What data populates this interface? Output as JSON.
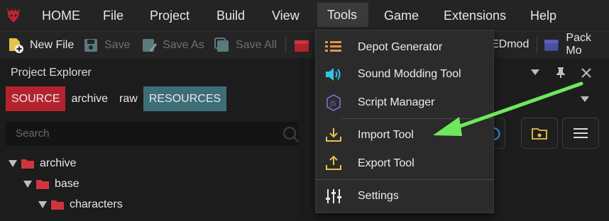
{
  "menubar": {
    "items": [
      "HOME",
      "File",
      "Project",
      "Build",
      "View",
      "Tools",
      "Game",
      "Extensions",
      "Help"
    ]
  },
  "toolbar": {
    "new_file": "New File",
    "save": "Save",
    "save_as": "Save As",
    "save_all": "Save All",
    "redmod": "EDmod",
    "pack_mod": "Pack Mo"
  },
  "explorer": {
    "title": "Project Explorer",
    "tabs": [
      "SOURCE",
      "archive",
      "raw",
      "RESOURCES"
    ],
    "search_placeholder": "Search",
    "tree": [
      {
        "label": "archive",
        "depth": 0
      },
      {
        "label": "base",
        "depth": 1
      },
      {
        "label": "characters",
        "depth": 2
      }
    ]
  },
  "tools_menu": {
    "items": [
      {
        "label": "Depot Generator",
        "icon": "list-icon"
      },
      {
        "label": "Sound Modding Tool",
        "icon": "speaker-icon"
      },
      {
        "label": "Script Manager",
        "icon": "js-icon"
      },
      {
        "label": "Import Tool",
        "icon": "download-icon"
      },
      {
        "label": "Export Tool",
        "icon": "upload-icon"
      },
      {
        "label": "Settings",
        "icon": "sliders-icon"
      }
    ]
  },
  "colors": {
    "accent_red": "#b3232e",
    "accent_teal": "#3d6e78",
    "icon_yellow": "#e4c44a",
    "icon_cyan": "#34c3e0",
    "icon_orange": "#e0964a",
    "arrow_green": "#6dea5b"
  }
}
